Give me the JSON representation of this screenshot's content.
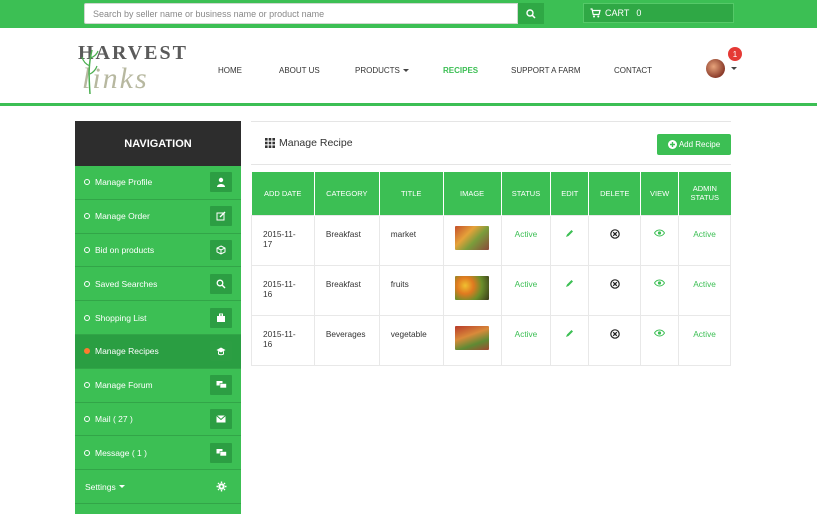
{
  "search": {
    "placeholder": "Search by seller name or business name or product name"
  },
  "cart": {
    "label": "CART",
    "count": "0"
  },
  "logo": {
    "top": "HARVEST",
    "bottom": "links"
  },
  "nav": [
    {
      "label": "HOME"
    },
    {
      "label": "ABOUT US"
    },
    {
      "label": "PRODUCTS"
    },
    {
      "label": "RECIPES"
    },
    {
      "label": "SUPPORT A FARM"
    },
    {
      "label": "CONTACT"
    }
  ],
  "user": {
    "notifications": "1"
  },
  "sidebar": {
    "title": "NAVIGATION",
    "items": [
      {
        "label": "Manage Profile",
        "icon": "user-icon"
      },
      {
        "label": "Manage Order",
        "icon": "edit-icon"
      },
      {
        "label": "Bid on products",
        "icon": "package-icon"
      },
      {
        "label": "Saved Searches",
        "icon": "search-icon"
      },
      {
        "label": "Shopping List",
        "icon": "briefcase-icon"
      },
      {
        "label": "Manage Recipes",
        "icon": "chef-hat-icon"
      },
      {
        "label": "Manage Forum",
        "icon": "chat-icon"
      },
      {
        "label": "Mail ( 27 )",
        "icon": "envelope-icon"
      },
      {
        "label": "Message ( 1 )",
        "icon": "chat-icon"
      },
      {
        "label": "Settings",
        "icon": "gear-icon"
      }
    ]
  },
  "page": {
    "title": "Manage Recipe",
    "add_label": "Add Recipe"
  },
  "table": {
    "headers": [
      "ADD DATE",
      "CATEGORY",
      "TITLE",
      "IMAGE",
      "STATUS",
      "EDIT",
      "DELETE",
      "VIEW",
      "ADMIN",
      "STATUS"
    ],
    "rows": [
      {
        "date_1": "2015-11-",
        "date_2": "17",
        "category": "Breakfast",
        "title": "market",
        "status": "Active",
        "admin_status": "Active"
      },
      {
        "date_1": "2015-11-",
        "date_2": "16",
        "category": "Breakfast",
        "title": "fruits",
        "status": "Active",
        "admin_status": "Active"
      },
      {
        "date_1": "2015-11-",
        "date_2": "16",
        "category": "Beverages",
        "title": "vegetable",
        "status": "Active",
        "admin_status": "Active"
      }
    ]
  },
  "colors": {
    "brand_green": "#3cbf54",
    "dark_header": "#2d2d2d",
    "active_dot": "#ff7a2e",
    "badge_red": "#e53935"
  }
}
